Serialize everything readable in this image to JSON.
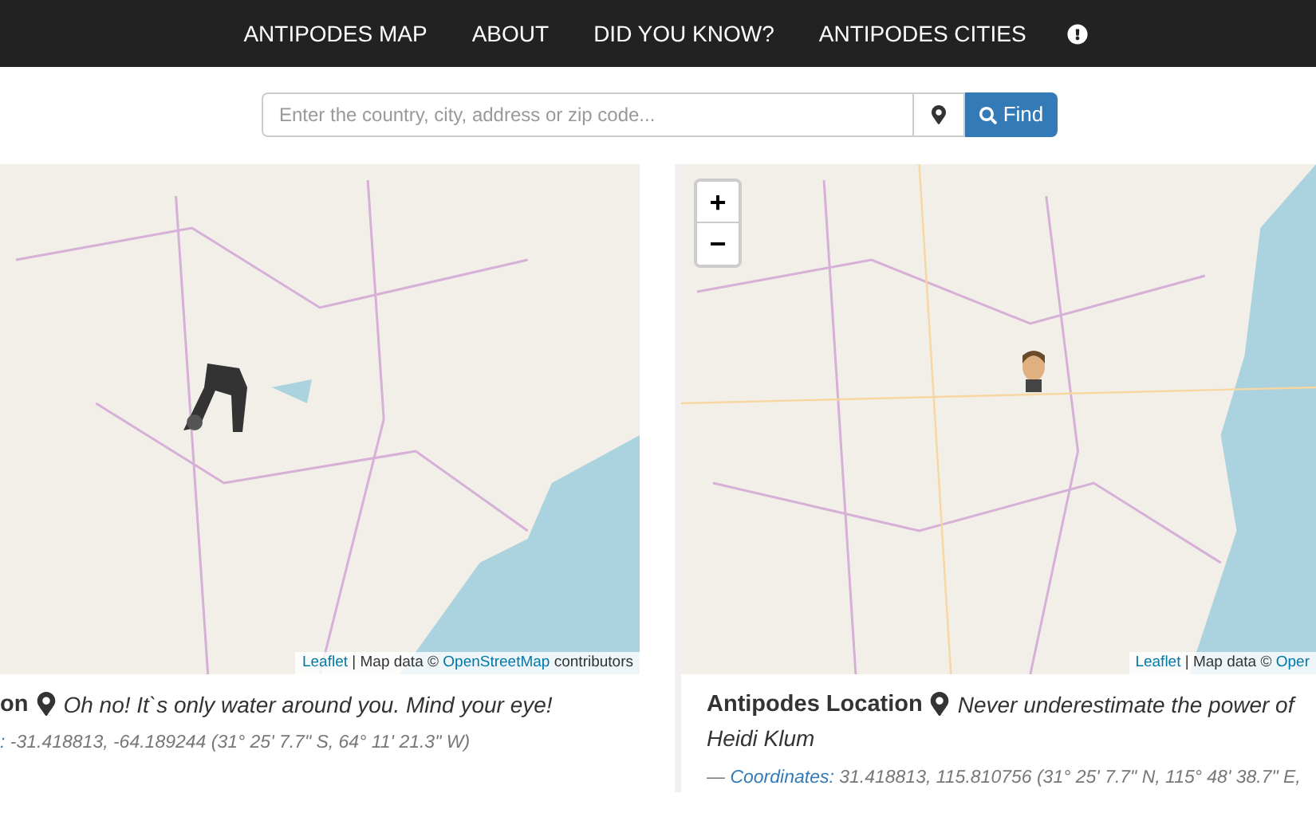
{
  "nav": {
    "items": [
      "ANTIPODES MAP",
      "ABOUT",
      "DID YOU KNOW?",
      "ANTIPODES CITIES"
    ]
  },
  "search": {
    "placeholder": "Enter the country, city, address or zip code...",
    "button": "Find"
  },
  "panels": [
    {
      "map": {
        "kind": "land_west"
      },
      "attribution": [
        {
          "kind": "link",
          "text": "Leaflet"
        },
        {
          "kind": "text",
          "text": " | Map data © "
        },
        {
          "kind": "link",
          "text": "OpenStreetMap"
        },
        {
          "kind": "text",
          "text": " contributors"
        }
      ],
      "title": "on",
      "message": [
        "Oh no! It`s only water around you. Mind your eye!"
      ],
      "coordinates": {
        "label": ":",
        "value": " -31.418813, -64.189244 (31° 25' 7.7\" S, 64° 11' 21.3\" W)"
      }
    },
    {
      "map": {
        "kind": "land_east",
        "zoom_controls": [
          "+",
          "−"
        ]
      },
      "attribution": [
        {
          "kind": "link",
          "text": "Leaflet"
        },
        {
          "kind": "text",
          "text": " | Map data © "
        },
        {
          "kind": "link",
          "text": "Oper"
        }
      ],
      "title": "Antipodes Location",
      "message": [
        "Never underestimate the power of",
        "Heidi Klum"
      ],
      "coordinates": {
        "dash": "— ",
        "label": "Coordinates:",
        "value": " 31.418813, 115.810756 (31° 25' 7.7\" N, 115° 48' 38.7\" E,"
      }
    }
  ]
}
